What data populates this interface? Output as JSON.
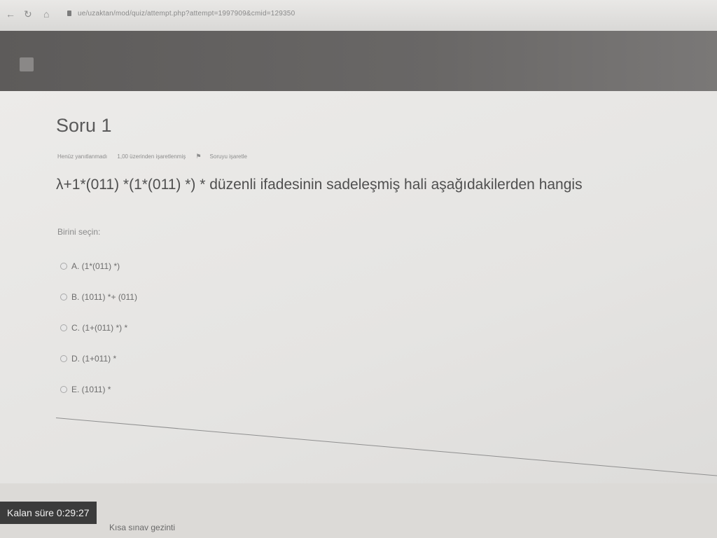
{
  "browser": {
    "back_icon": "arrow-left-icon",
    "reload_icon": "reload-icon",
    "home_icon": "home-icon",
    "url": "ue/uzaktan/mod/quiz/attempt.php?attempt=1997909&cmid=129350"
  },
  "header": {
    "site_name_line1": "",
    "site_name_line2": ""
  },
  "question": {
    "title": "Soru 1",
    "status": "Henüz yanıtlanmadı",
    "points": "1,00 üzerinden işaretlenmiş",
    "flag_label": "Soruyu işaretle",
    "text": "λ+1*(011) *(1*(011) *) * düzenli ifadesinin sadeleşmiş hali aşağıdakilerden hangis",
    "prompt": "Birini seçin:",
    "options": [
      {
        "label": "A. (1*(011) *)"
      },
      {
        "label": "B. (1011) *+ (011)"
      },
      {
        "label": "C. (1+(011) *) *"
      },
      {
        "label": "D. (1+011) *"
      },
      {
        "label": "E. (1011) *"
      }
    ]
  },
  "footer": {
    "timer": "Kalan süre 0:29:27",
    "next_link": "Kısa sınav gezinti"
  }
}
